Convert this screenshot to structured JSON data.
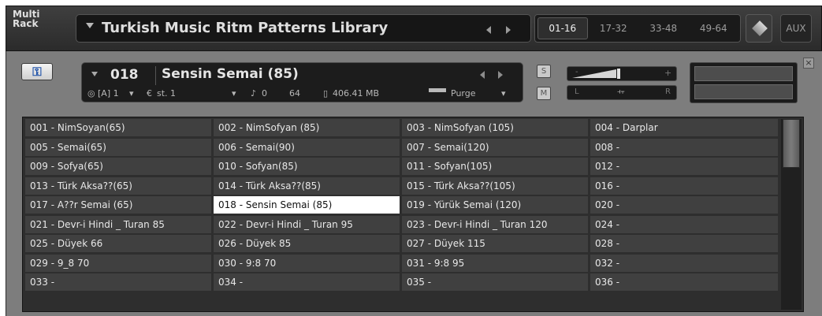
{
  "rack": {
    "label": "Multi\nRack",
    "title": "Turkish Music Ritm Patterns Library",
    "page_tabs": [
      "01-16",
      "17-32",
      "33-48",
      "49-64"
    ],
    "active_page_tab": 0,
    "aux_label": "AUX"
  },
  "instrument": {
    "number": "018",
    "name": "Sensin Semai (85)",
    "midi_channel": "[A] 1",
    "output": "st. 1",
    "voices": "0",
    "max_voices": "64",
    "memory": "406.41 MB",
    "purge_label": "Purge",
    "solo_label": "S",
    "mute_label": "M",
    "volume_level_fraction": 0.45,
    "pan_left_label": "L",
    "pan_right_label": "R",
    "volume_minus_label": "-",
    "volume_plus_label": "+"
  },
  "slots": [
    "001 -  NimSoyan(65)",
    "002 - NimSofyan (85)",
    "003 - NimSofyan (105)",
    "004 - Darplar",
    "005  - Semai(65)",
    "006 - Semai(90)",
    "007 - Semai(120)",
    "008 -",
    "009 - Sofya(65)",
    "010 - Sofyan(85)",
    "011 - Sofyan(105)",
    "012 -",
    "013 - Türk Aksa??(65)",
    "014 - Türk Aksa??(85)",
    "015 - Türk Aksa??(105)",
    "016 -",
    "017 - A??r Semai (65)",
    "018 - Sensin Semai (85)",
    "019 - Yürük Semai (120)",
    "020 -",
    "021 - Devr-i Hindi _ Turan 85",
    "022 - Devr-i Hindi _ Turan 95",
    "023 - Devr-i Hindi _ Turan 120",
    "024 -",
    "025 - Düyek 66",
    "026 - Düyek 85",
    "027 - Düyek 115",
    "028 -",
    "029 - 9_8 70",
    "030 - 9:8 70",
    "031 - 9:8 95",
    "032 -",
    "033 -",
    "034 -",
    "035 -",
    "036 -"
  ],
  "selected_slot": 17,
  "colors": {
    "rack_bg": "#333333",
    "panel_bg": "#7d7d7d",
    "slot_bg": "#404040",
    "slot_selected_bg": "#ffffff",
    "wrench_icon": "#1b4fa8"
  }
}
